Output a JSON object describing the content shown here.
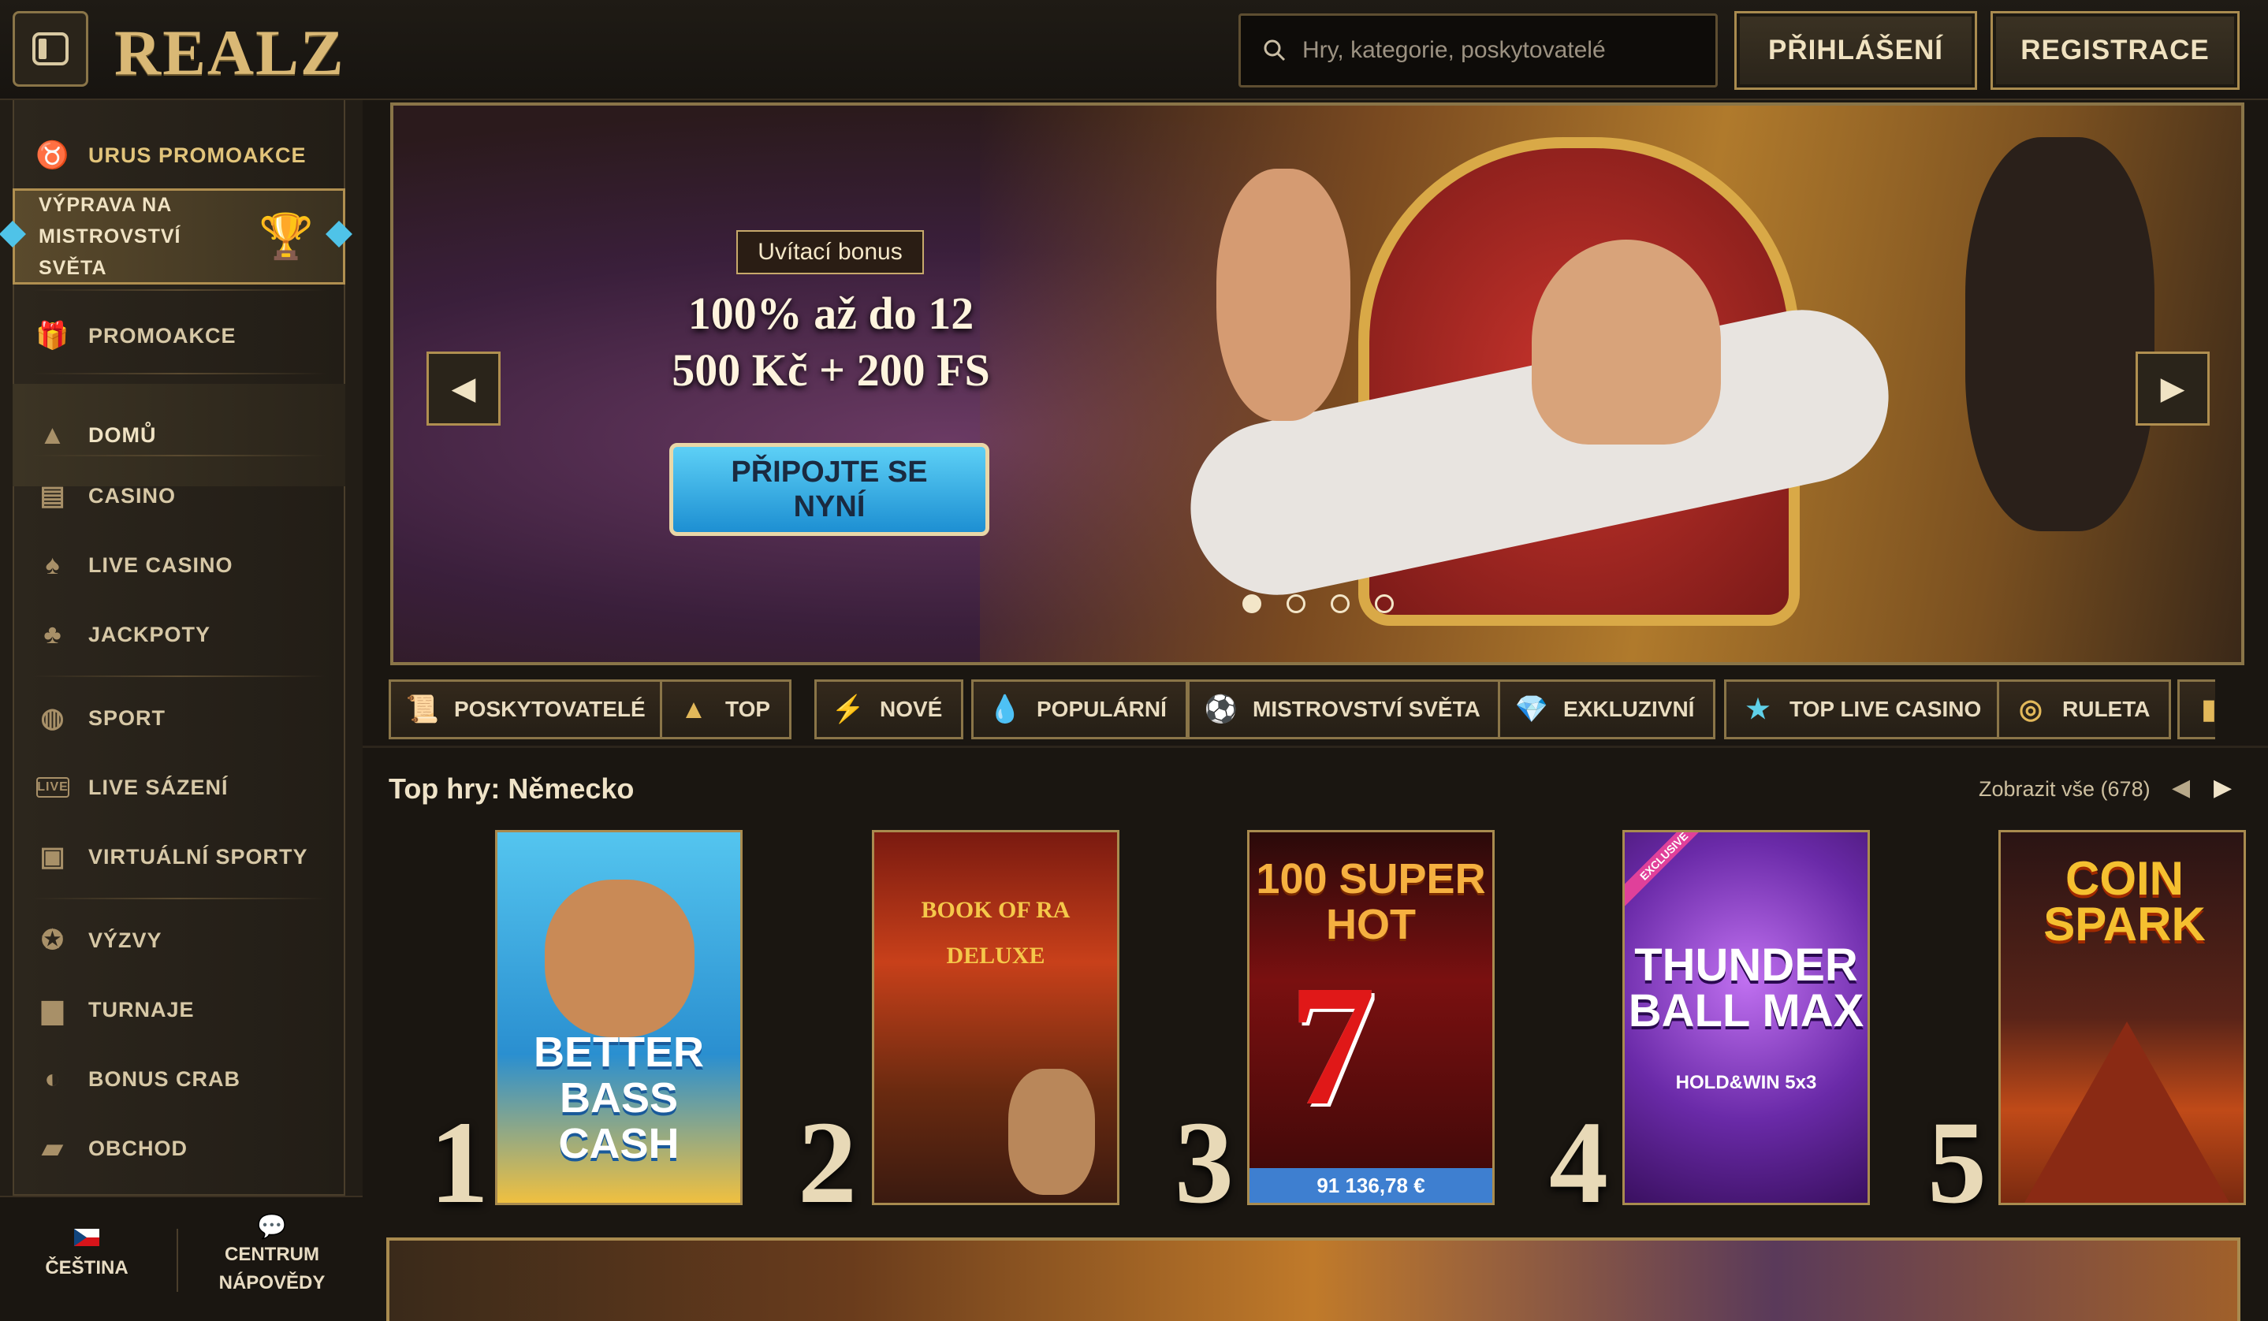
{
  "header": {
    "logo": "REALZ",
    "search_placeholder": "Hry, kategorie, poskytovatelé",
    "login_label": "PŘIHLÁŠENÍ",
    "register_label": "REGISTRACE"
  },
  "sidebar": {
    "promo_special": "URUS PROMOAKCE",
    "world_cup": "VÝPRAVA NA MISTROVSTVÍ SVĚTA",
    "items": [
      {
        "label": "PROMOAKCE",
        "icon": "gift-icon"
      },
      {
        "label": "DOMŮ",
        "icon": "home-icon"
      },
      {
        "label": "CASINO",
        "icon": "slot-machine-icon"
      },
      {
        "label": "LIVE CASINO",
        "icon": "card-icon"
      },
      {
        "label": "JACKPOTY",
        "icon": "clover-icon"
      },
      {
        "label": "SPORT",
        "icon": "basketball-icon"
      },
      {
        "label": "LIVE SÁZENÍ",
        "icon": "live-icon"
      },
      {
        "label": "VIRTUÁLNÍ SPORTY",
        "icon": "virtual-sport-icon"
      },
      {
        "label": "VÝZVY",
        "icon": "badge-icon"
      },
      {
        "label": "TURNAJE",
        "icon": "podium-icon"
      },
      {
        "label": "BONUS CRAB",
        "icon": "crab-icon"
      },
      {
        "label": "OBCHOD",
        "icon": "shopping-bag-icon"
      }
    ],
    "language": "ČEŠTINA",
    "help_line1": "CENTRUM",
    "help_line2": "NÁPOVĚDY"
  },
  "hero": {
    "badge": "Uvítací bonus",
    "headline_line1": "100% až do 12",
    "headline_line2": "500 Kč + 200 FS",
    "cta_line1": "PŘIPOJTE SE",
    "cta_line2": "NYNÍ",
    "slides": 4,
    "active_slide": 1
  },
  "categories": [
    {
      "label": "POSKYTOVATELÉ",
      "icon": "scroll-icon"
    },
    {
      "label": "TOP",
      "icon": "pyramid-icon"
    },
    {
      "label": "NOVÉ",
      "icon": "lightning-icon"
    },
    {
      "label": "POPULÁRNÍ",
      "icon": "drop-icon"
    },
    {
      "label": "MISTROVSTVÍ SVĚTA",
      "icon": "football-icon"
    },
    {
      "label": "EXKLUZIVNÍ",
      "icon": "diamond-icon"
    },
    {
      "label": "TOP LIVE CASINO",
      "icon": "star-icon"
    },
    {
      "label": "RULETA",
      "icon": "roulette-icon"
    }
  ],
  "top_games": {
    "title": "Top hry: Německo",
    "view_all": "Zobrazit vše (678)",
    "games": [
      {
        "rank": "1",
        "title": "BETTER BASS CASH"
      },
      {
        "rank": "2",
        "title": "BOOK OF RA DELUXE"
      },
      {
        "rank": "3",
        "title": "100 SUPER HOT",
        "jackpot": "91 136,78 €"
      },
      {
        "rank": "4",
        "title": "THUNDER BALL MAX",
        "subtitle": "HOLD&WIN 5x3",
        "tag": "EXCLUSIVE"
      },
      {
        "rank": "5",
        "title": "COIN SPARK"
      }
    ]
  },
  "colors": {
    "accent_gold": "#a98b4f",
    "cta_blue": "#1d8fd2",
    "background": "#1a1611"
  }
}
